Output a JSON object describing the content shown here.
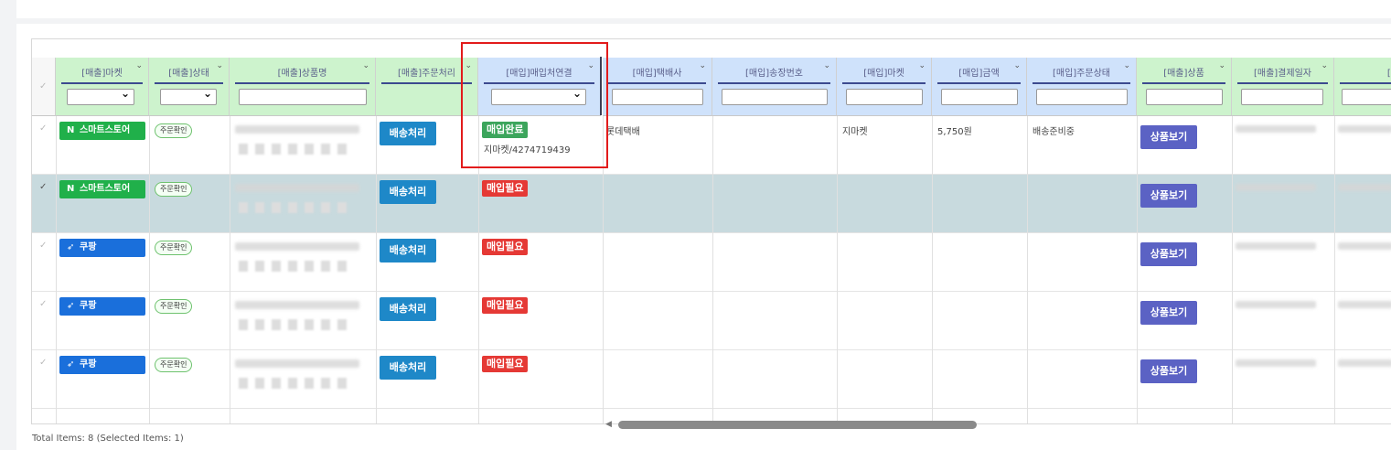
{
  "columns": [
    {
      "label": "[매출]마켓"
    },
    {
      "label": "[매출]상태"
    },
    {
      "label": "[매출]상품명"
    },
    {
      "label": "[매출]주문처리"
    },
    {
      "label": "[매입]매입처연결"
    },
    {
      "label": "[매입]택배사"
    },
    {
      "label": "[매입]송장번호"
    },
    {
      "label": "[매입]마켓"
    },
    {
      "label": "[매입]금액"
    },
    {
      "label": "[매입]주문상태"
    },
    {
      "label": "[매출]상품"
    },
    {
      "label": "[매출]결제일자"
    },
    {
      "label": "[매"
    }
  ],
  "rows": [
    {
      "market": "스마트스토어",
      "market_type": "naver",
      "market_icon": "N",
      "status": "주문확인",
      "ship_label": "배송처리",
      "purchase_badge": "매입완료",
      "purchase_state": "ok",
      "purchase_detail": "지마켓/4274719439",
      "courier": "롯데택배",
      "buy_market": "지마켓",
      "amount": "5,750원",
      "order_status": "배송준비중",
      "view_label": "상품보기",
      "selected": false
    },
    {
      "market": "스마트스토어",
      "market_type": "naver",
      "market_icon": "N",
      "status": "주문확인",
      "ship_label": "배송처리",
      "purchase_badge": "매입필요",
      "purchase_state": "need",
      "purchase_detail": "",
      "courier": "",
      "buy_market": "",
      "amount": "",
      "order_status": "",
      "view_label": "상품보기",
      "selected": true
    },
    {
      "market": "쿠팡",
      "market_type": "coupang",
      "market_icon": "rocket",
      "status": "주문확인",
      "ship_label": "배송처리",
      "purchase_badge": "매입필요",
      "purchase_state": "need",
      "purchase_detail": "",
      "courier": "",
      "buy_market": "",
      "amount": "",
      "order_status": "",
      "view_label": "상품보기",
      "selected": false
    },
    {
      "market": "쿠팡",
      "market_type": "coupang",
      "market_icon": "rocket",
      "status": "주문확인",
      "ship_label": "배송처리",
      "purchase_badge": "매입필요",
      "purchase_state": "need",
      "purchase_detail": "",
      "courier": "",
      "buy_market": "",
      "amount": "",
      "order_status": "",
      "view_label": "상품보기",
      "selected": false
    },
    {
      "market": "쿠팡",
      "market_type": "coupang",
      "market_icon": "rocket",
      "status": "주문확인",
      "ship_label": "배송처리",
      "purchase_badge": "매입필요",
      "purchase_state": "need",
      "purchase_detail": "",
      "courier": "",
      "buy_market": "",
      "amount": "",
      "order_status": "",
      "view_label": "상품보기",
      "selected": false
    }
  ],
  "footer": {
    "text": "Total Items: 8 (Selected Items: 1)"
  },
  "colors": {
    "naver": "#20b04a",
    "coupang": "#1a6fdb",
    "highlight": "#e21b1b"
  }
}
